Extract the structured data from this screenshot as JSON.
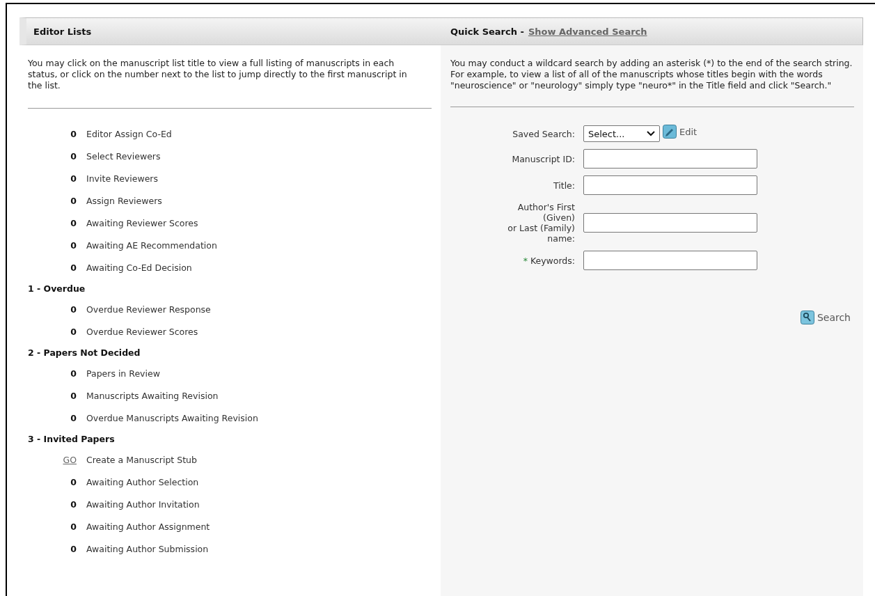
{
  "editor_lists": {
    "title": "Editor Lists",
    "description": "You may click on the manuscript list title to view a full listing of manuscripts in each status, or click on the number next to the list to jump directly to the first manuscript in the list.",
    "groups": [
      {
        "items": [
          {
            "kind": "count",
            "count": "0",
            "label": "Editor Assign Co-Ed"
          },
          {
            "kind": "count",
            "count": "0",
            "label": "Select Reviewers"
          },
          {
            "kind": "count",
            "count": "0",
            "label": "Invite Reviewers"
          },
          {
            "kind": "count",
            "count": "0",
            "label": "Assign Reviewers"
          },
          {
            "kind": "count",
            "count": "0",
            "label": "Awaiting Reviewer Scores"
          },
          {
            "kind": "count",
            "count": "0",
            "label": "Awaiting AE Recommendation"
          },
          {
            "kind": "count",
            "count": "0",
            "label": "Awaiting Co-Ed Decision"
          }
        ]
      },
      {
        "heading": "1 - Overdue",
        "items": [
          {
            "kind": "count",
            "count": "0",
            "label": "Overdue Reviewer Response"
          },
          {
            "kind": "count",
            "count": "0",
            "label": "Overdue Reviewer Scores"
          }
        ]
      },
      {
        "heading": "2 - Papers Not Decided",
        "items": [
          {
            "kind": "count",
            "count": "0",
            "label": "Papers in Review"
          },
          {
            "kind": "count",
            "count": "0",
            "label": "Manuscripts Awaiting Revision"
          },
          {
            "kind": "count",
            "count": "0",
            "label": "Overdue Manuscripts Awaiting Revision"
          }
        ]
      },
      {
        "heading": "3 - Invited Papers",
        "items": [
          {
            "kind": "go",
            "count": "GO",
            "label": "Create a Manuscript Stub"
          },
          {
            "kind": "count",
            "count": "0",
            "label": "Awaiting Author Selection"
          },
          {
            "kind": "count",
            "count": "0",
            "label": "Awaiting Author Invitation"
          },
          {
            "kind": "count",
            "count": "0",
            "label": "Awaiting Author Assignment"
          },
          {
            "kind": "count",
            "count": "0",
            "label": "Awaiting Author Submission"
          }
        ]
      }
    ]
  },
  "quick_search": {
    "title": "Quick Search -",
    "advanced_link": "Show Advanced Search",
    "description": "You may conduct a wildcard search by adding an asterisk (*) to the end of the search string. For example, to view a list of all of the manuscripts whose titles begin with the words \"neuroscience\" or \"neurology\" simply type \"neuro*\" in the Title field and click \"Search.\"",
    "fields": [
      {
        "kind": "select",
        "label": "Saved Search:",
        "value": "Select...",
        "edit": "Edit"
      },
      {
        "kind": "text",
        "label": "Manuscript ID:"
      },
      {
        "kind": "text",
        "label": "Title:"
      },
      {
        "kind": "text",
        "label": "Author's First (Given)\nor Last (Family) name:"
      },
      {
        "kind": "text",
        "label": "Keywords:",
        "required_mark": "*"
      }
    ],
    "search_button": "Search"
  }
}
